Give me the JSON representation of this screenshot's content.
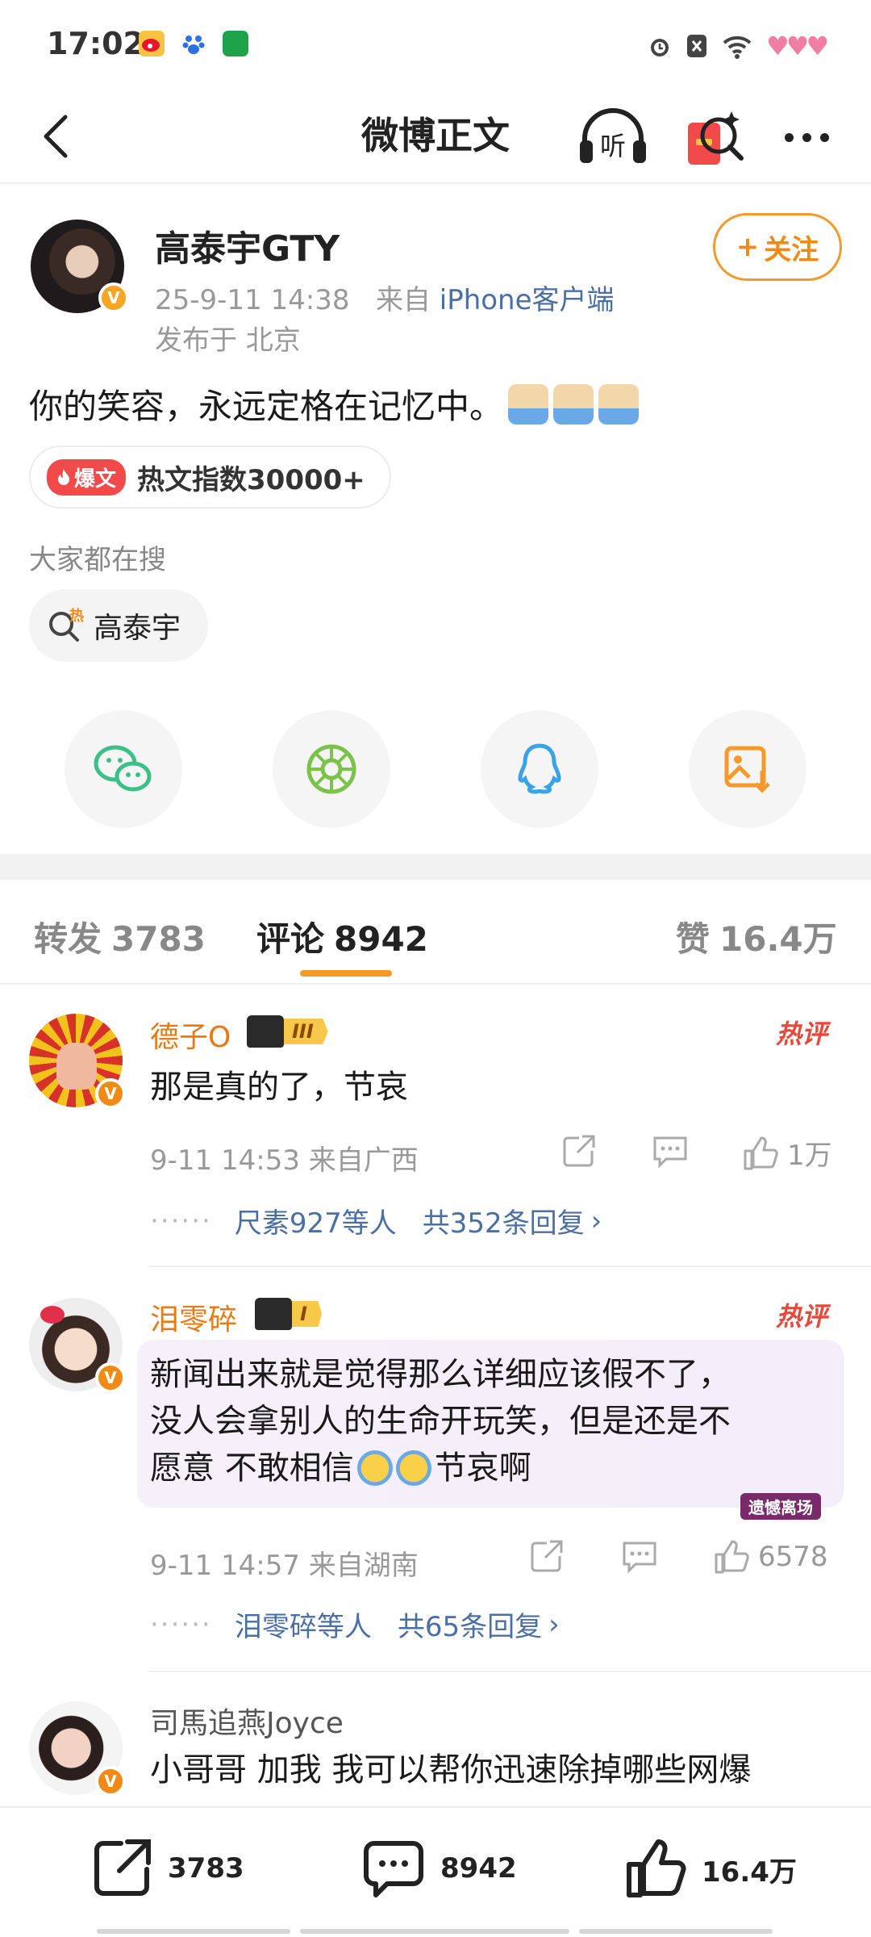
{
  "status_bar": {
    "time": "17:02",
    "app_icons": [
      "weibo-icon",
      "baidu-paw-icon",
      "green-app-icon"
    ],
    "system_icons": [
      "alarm-icon",
      "sim-off-icon",
      "wifi-icon",
      "hearts-icon"
    ]
  },
  "nav": {
    "title": "微博正文",
    "listen_label": "听"
  },
  "post": {
    "author": "高泰宇GTY",
    "time": "25-9-11 14:38",
    "source_prefix": "来自",
    "source_client": "iPhone客户端",
    "location": "发布于 北京",
    "follow_label": "关注",
    "follow_plus": "+",
    "text": "你的笑容，永远定格在记忆中。",
    "hot_tag": "爆文",
    "hot_index": "热文指数30000+",
    "search_title": "大家都在搜",
    "search_chip": "高泰宇",
    "search_chip_badge": "热"
  },
  "share": [
    "wechat-icon",
    "moments-icon",
    "qq-icon",
    "save-image-icon"
  ],
  "tabs": {
    "repost_label": "转发",
    "repost_count": "3783",
    "comment_label": "评论",
    "comment_count": "8942",
    "like_label": "赞",
    "like_count": "16.4万"
  },
  "comments": [
    {
      "name": "德子O",
      "level": "III",
      "hot": "热评",
      "text": "那是真的了，节哀",
      "time_place": "9-11 14:53  来自广西",
      "likes": "1万",
      "reply_users": "尺素927等人",
      "reply_count": "共352条回复",
      "chevron": "›",
      "dots": "······"
    },
    {
      "name": "泪零碎",
      "level": "I",
      "hot": "热评",
      "text_line1": "新闻出来就是觉得那么详细应该假不了，",
      "text_line2": "没人会拿别人的生命开玩笑，但是还是不",
      "text_line3": "愿意 不敢相信",
      "text_line3_tail": "节哀啊",
      "bubble_brand": "遗憾离场",
      "time_place": "9-11 14:57  来自湖南",
      "likes": "6578",
      "reply_users": "泪零碎等人",
      "reply_count": "共65条回复",
      "chevron": "›",
      "dots": "······"
    },
    {
      "name": "司馬追燕Joyce",
      "text": "小哥哥 加我 我可以帮你迅速除掉哪些网爆"
    }
  ],
  "bottom_bar": {
    "repost_count": "3783",
    "comment_count": "8942",
    "like_count": "16.4万"
  },
  "colors": {
    "accent": "#f39a2b",
    "link": "#4a6fa5",
    "hot": "#e8483b",
    "verified": "#f5a623"
  }
}
